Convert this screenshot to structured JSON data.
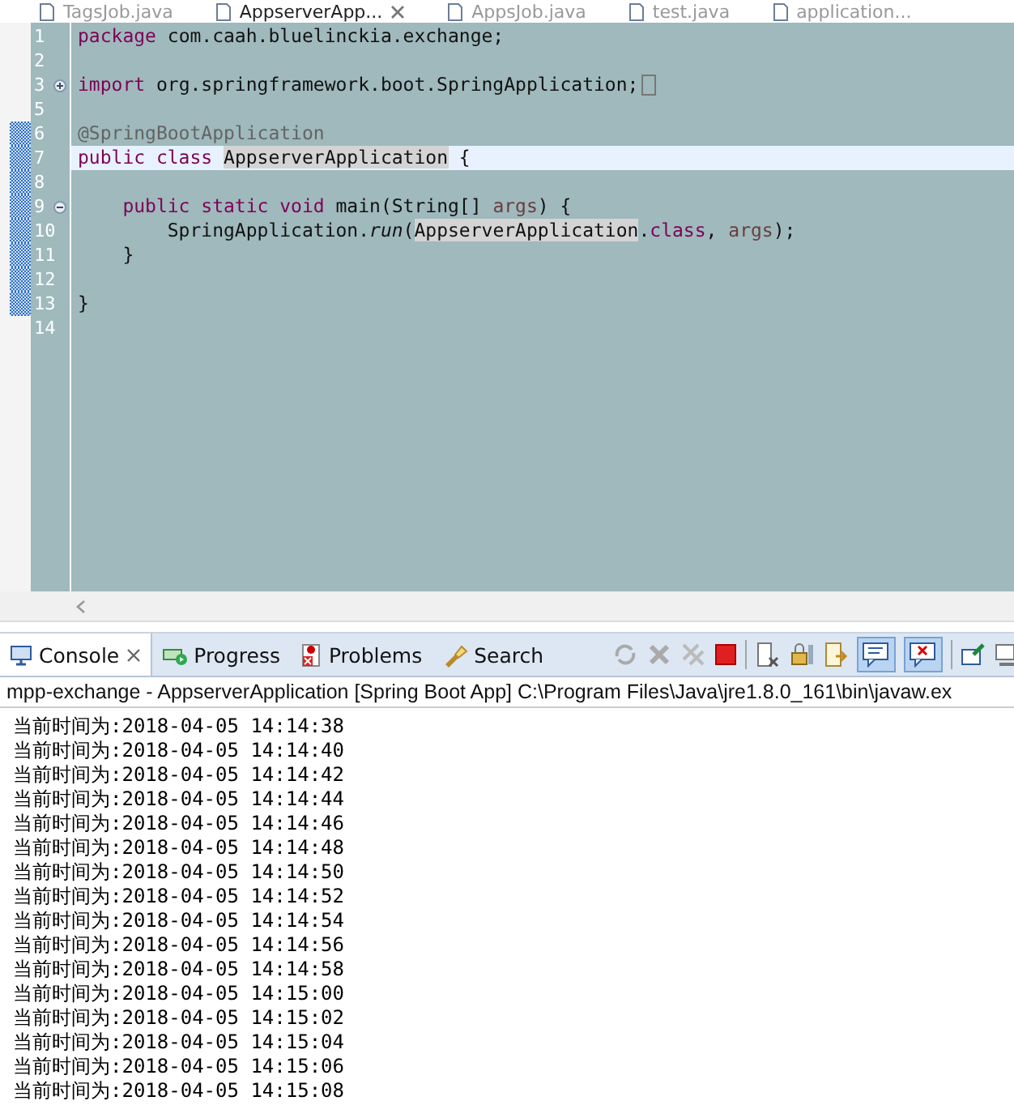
{
  "editor": {
    "tabs": [
      {
        "label": "TagsJob.java",
        "selected": false
      },
      {
        "label": "AppserverApp...",
        "selected": true
      },
      {
        "label": "AppsJob.java",
        "selected": false
      },
      {
        "label": "test.java",
        "selected": false
      },
      {
        "label": "application...",
        "selected": false
      }
    ],
    "lines": [
      {
        "number": "1",
        "current": false,
        "changed": false,
        "tokens": [
          {
            "text": "package",
            "kind": "keyword"
          },
          {
            "text": " com.caah.bluelinckia.exchange;",
            "kind": "plain"
          }
        ]
      },
      {
        "number": "2",
        "current": false,
        "changed": false
      },
      {
        "number": "3",
        "current": false,
        "changed": false,
        "folding": {
          "collapsed": true
        },
        "tokens": [
          {
            "text": "import",
            "kind": "keyword"
          },
          {
            "text": " org.springframework.boot.SpringApplication;",
            "kind": "plain"
          }
        ]
      },
      {
        "number": "5",
        "current": false,
        "changed": false
      },
      {
        "number": "6",
        "current": false,
        "changed": true,
        "tokens": [
          {
            "text": "@SpringBootApplication",
            "kind": "annotation"
          }
        ]
      },
      {
        "number": "7",
        "current": true,
        "changed": true,
        "tokens": [
          {
            "text": "public class ",
            "kind": "keyword"
          },
          {
            "text": "AppserverApplication",
            "kind": "occurrence"
          },
          {
            "text": " {",
            "kind": "plain"
          }
        ]
      },
      {
        "number": "8",
        "current": false,
        "changed": true
      },
      {
        "number": "9",
        "current": false,
        "changed": true,
        "folding": {
          "collapsed": false
        },
        "tokens": [
          {
            "text": "    public static void",
            "kind": "keyword"
          },
          {
            "text": " main(String[] ",
            "kind": "plain"
          },
          {
            "text": "args",
            "kind": "param"
          },
          {
            "text": ") {",
            "kind": "plain"
          }
        ]
      },
      {
        "number": "10",
        "current": false,
        "changed": true,
        "tokens": [
          {
            "text": "        SpringApplication.",
            "kind": "plain"
          },
          {
            "text": "run",
            "kind": "static"
          },
          {
            "text": "(",
            "kind": "plain"
          },
          {
            "text": "AppserverApplication",
            "kind": "occurrence"
          },
          {
            "text": ".",
            "kind": "plain"
          },
          {
            "text": "class",
            "kind": "keyword"
          },
          {
            "text": ", ",
            "kind": "plain"
          },
          {
            "text": "args",
            "kind": "param"
          },
          {
            "text": ");",
            "kind": "plain"
          }
        ]
      },
      {
        "number": "11",
        "current": false,
        "changed": true,
        "tokens": [
          {
            "text": "    }",
            "kind": "plain"
          }
        ]
      },
      {
        "number": "12",
        "current": false,
        "changed": true
      },
      {
        "number": "13",
        "current": false,
        "changed": true,
        "tokens": [
          {
            "text": "}",
            "kind": "plain"
          }
        ]
      },
      {
        "number": "14",
        "current": false,
        "changed": false
      }
    ]
  },
  "console": {
    "tabs": [
      {
        "label": "Console",
        "selected": true,
        "kind": "console"
      },
      {
        "label": "Progress",
        "selected": false,
        "kind": "progress"
      },
      {
        "label": "Problems",
        "selected": false,
        "kind": "problems"
      },
      {
        "label": "Search",
        "selected": false,
        "kind": "search"
      }
    ],
    "header": "mpp-exchange - AppserverApplication [Spring Boot App] C:\\Program Files\\Java\\jre1.8.0_161\\bin\\javaw.ex",
    "lines": [
      "当前时间为:2018-04-05 14:14:38",
      "当前时间为:2018-04-05 14:14:40",
      "当前时间为:2018-04-05 14:14:42",
      "当前时间为:2018-04-05 14:14:44",
      "当前时间为:2018-04-05 14:14:46",
      "当前时间为:2018-04-05 14:14:48",
      "当前时间为:2018-04-05 14:14:50",
      "当前时间为:2018-04-05 14:14:52",
      "当前时间为:2018-04-05 14:14:54",
      "当前时间为:2018-04-05 14:14:56",
      "当前时间为:2018-04-05 14:14:58",
      "当前时间为:2018-04-05 14:15:00",
      "当前时间为:2018-04-05 14:15:02",
      "当前时间为:2018-04-05 14:15:04",
      "当前时间为:2018-04-05 14:15:06",
      "当前时间为:2018-04-05 14:15:08"
    ]
  }
}
